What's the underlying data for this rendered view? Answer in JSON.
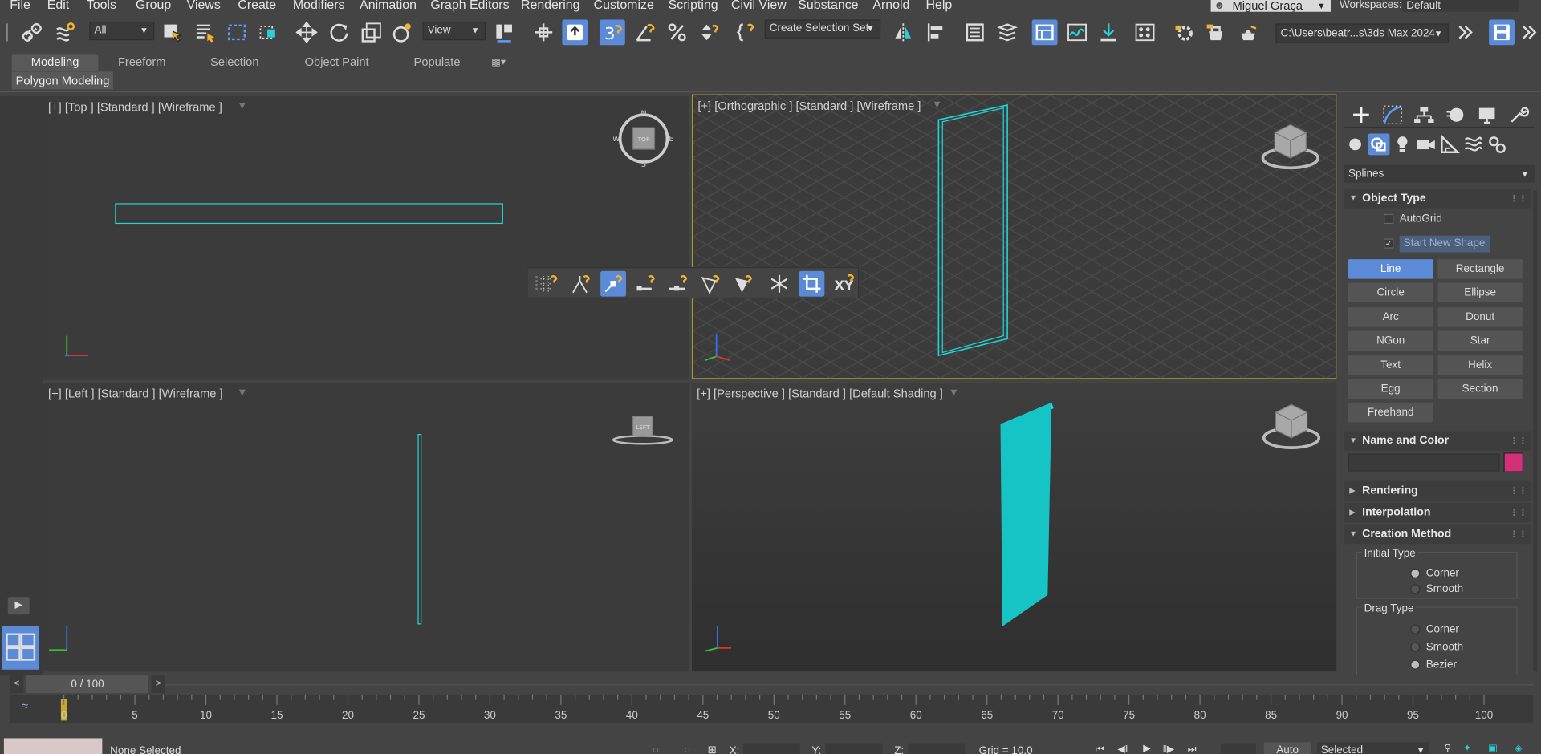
{
  "menu": [
    "File",
    "Edit",
    "Tools",
    "Group",
    "Views",
    "Create",
    "Modifiers",
    "Animation",
    "Graph Editors",
    "Rendering",
    "Customize",
    "Scripting",
    "Civil View",
    "Substance",
    "Arnold",
    "Help"
  ],
  "user": {
    "name": "Miguel Graça"
  },
  "workspaces": {
    "label": "Workspaces:",
    "value": "Default"
  },
  "toolbar": {
    "filter_value": "All",
    "ref_coord_value": "View",
    "selection_set_placeholder": "Create Selection Set",
    "project_path": "C:\\Users\\beatr...s\\3ds Max 2024"
  },
  "ribbon": {
    "tabs": [
      "Modeling",
      "Freeform",
      "Selection",
      "Object Paint",
      "Populate"
    ],
    "sub_label": "Polygon Modeling"
  },
  "viewports": {
    "top": {
      "label": "[+] [Top ] [Standard ] [Wireframe ]",
      "cube": "TOP",
      "compass": {
        "n": "N",
        "s": "S",
        "e": "E",
        "w": "W"
      }
    },
    "ortho": {
      "label": "[+] [Orthographic ] [Standard ] [Wireframe ]"
    },
    "left": {
      "label": "[+] [Left ] [Standard ] [Wireframe ]",
      "cube": "LEFT"
    },
    "persp": {
      "label": "[+] [Perspective ] [Standard ] [Default Shading ]"
    }
  },
  "snap_toolbar": {
    "xy_label": "XY"
  },
  "command_panel": {
    "category_value": "Splines",
    "object_type": {
      "title": "Object Type",
      "autogrid": "AutoGrid",
      "start_new_shape": "Start New Shape",
      "buttons": [
        "Line",
        "Rectangle",
        "Circle",
        "Ellipse",
        "Arc",
        "Donut",
        "NGon",
        "Star",
        "Text",
        "Helix",
        "Egg",
        "Section",
        "Freehand"
      ]
    },
    "name_color": {
      "title": "Name and Color",
      "color": "#d3307a"
    },
    "rendering": {
      "title": "Rendering"
    },
    "interpolation": {
      "title": "Interpolation"
    },
    "creation_method": {
      "title": "Creation Method",
      "initial_type": "Initial Type",
      "initial_options": [
        "Corner",
        "Smooth"
      ],
      "drag_type": "Drag Type",
      "drag_options": [
        "Corner",
        "Smooth",
        "Bezier"
      ]
    }
  },
  "time": {
    "frame_label": "0 / 100",
    "ticks": [
      "0",
      "5",
      "10",
      "15",
      "20",
      "25",
      "30",
      "35",
      "40",
      "45",
      "50",
      "55",
      "60",
      "65",
      "70",
      "75",
      "80",
      "85",
      "90",
      "95",
      "100"
    ]
  },
  "status": {
    "selection": "None Selected",
    "x_label": "X:",
    "y_label": "Y:",
    "z_label": "Z:",
    "grid": "Grid = 10,0",
    "auto": "Auto",
    "selected_value": "Selected"
  },
  "colors": {
    "accent": "#5b8bd6",
    "wire": "#22d3d8",
    "shape_fill": "#16c4c6",
    "snap_icon": "#f2b233"
  }
}
